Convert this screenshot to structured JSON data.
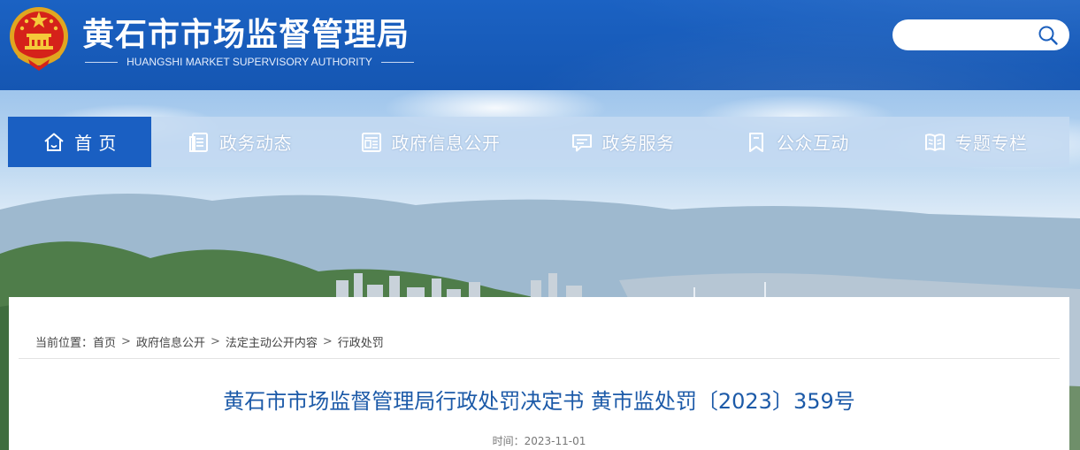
{
  "header": {
    "title": "黄石市市场监督管理局",
    "subtitle": "HUANGSHI MARKET SUPERVISORY AUTHORITY",
    "search": {
      "value": "",
      "placeholder": ""
    },
    "colors": {
      "header_bg": "#1b62c3",
      "accent": "#1a5fc2"
    }
  },
  "nav": {
    "items": [
      {
        "label": "首 页",
        "icon": "home-icon",
        "active": true
      },
      {
        "label": "政务动态",
        "icon": "document-list-icon",
        "active": false
      },
      {
        "label": "政府信息公开",
        "icon": "newspaper-icon",
        "active": false
      },
      {
        "label": "政务服务",
        "icon": "chat-bubble-icon",
        "active": false
      },
      {
        "label": "公众互动",
        "icon": "bookmark-icon",
        "active": false
      },
      {
        "label": "专题专栏",
        "icon": "open-book-icon",
        "active": false
      }
    ]
  },
  "breadcrumb": {
    "prefix": "当前位置：",
    "items": [
      "首页",
      "政府信息公开",
      "法定主动公开内容",
      "行政处罚"
    ],
    "separator": ">"
  },
  "article": {
    "title": "黄石市市场监督管理局行政处罚决定书 黄市监处罚〔2023〕359号",
    "meta": "时间：2023-11-01"
  }
}
